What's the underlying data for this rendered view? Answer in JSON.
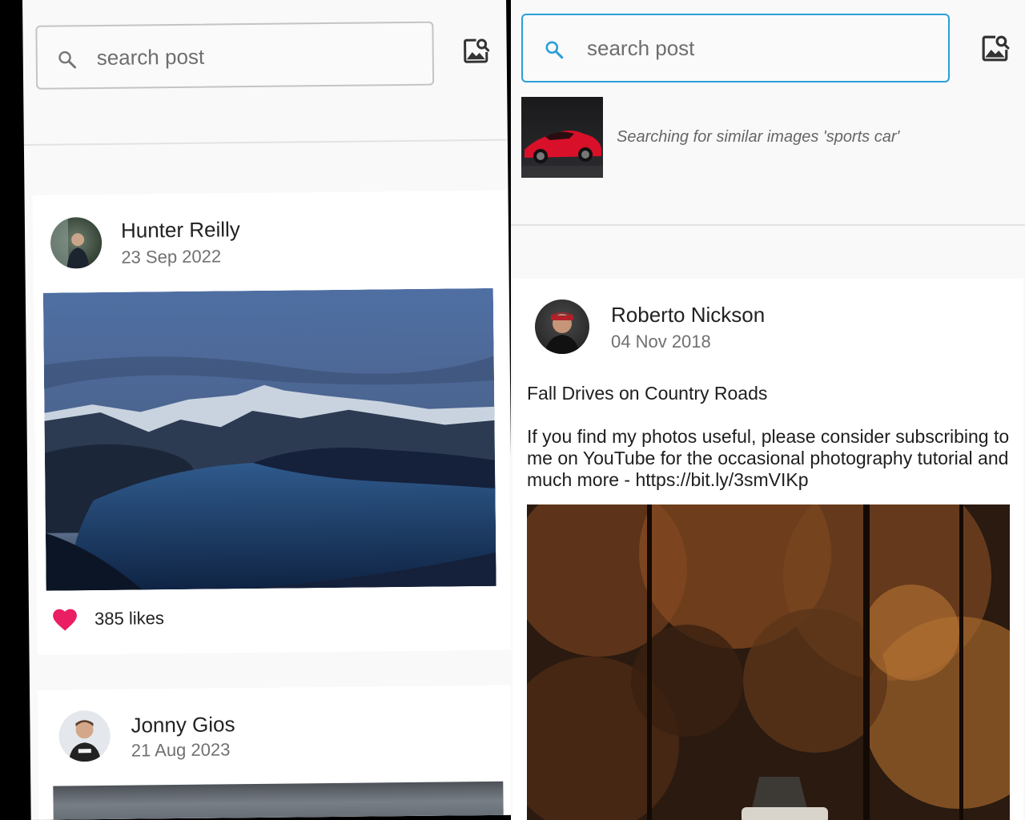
{
  "left": {
    "search": {
      "placeholder": "search post"
    },
    "posts": [
      {
        "author": "Hunter Reilly",
        "date": "23 Sep 2022",
        "likes": "385 likes"
      },
      {
        "author": "Jonny Gios",
        "date": "21 Aug 2023"
      }
    ]
  },
  "right": {
    "search": {
      "placeholder": "search post"
    },
    "similar": {
      "text": "Searching for similar images 'sports car'"
    },
    "post": {
      "author": "Roberto Nickson",
      "date": "04 Nov 2018",
      "title": "Fall Drives on Country Roads",
      "body": "If you find my photos useful, please consider subscribing to me on YouTube for the occasional photography tutorial and much more - https://bit.ly/3smVIKp"
    }
  },
  "colors": {
    "accent": "#2a9fd8",
    "heart": "#e91e63",
    "background": "#f9f9f9",
    "card": "#ffffff"
  },
  "icons": [
    "search-icon",
    "image-search-icon",
    "heart-icon"
  ]
}
